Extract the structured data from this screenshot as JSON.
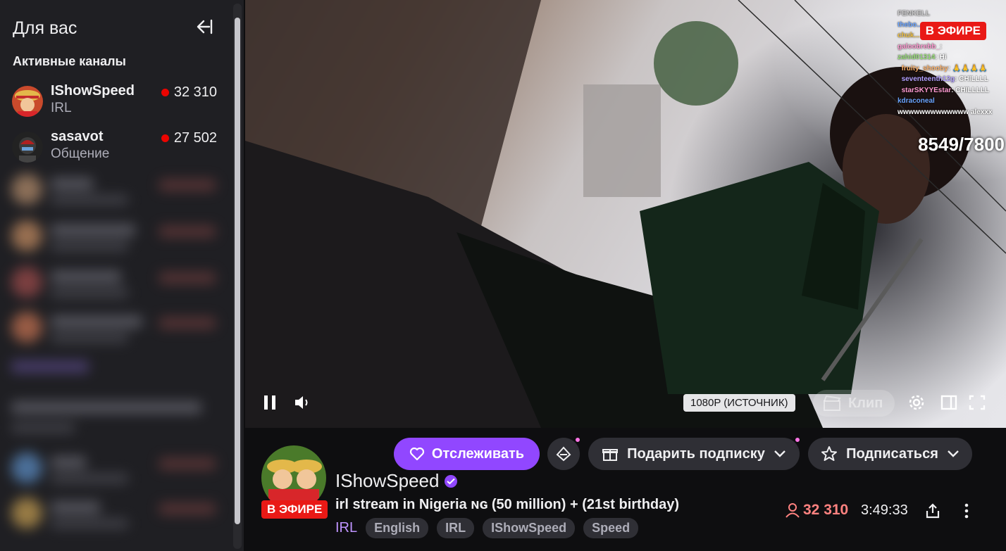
{
  "sidebar": {
    "header": "Для вас",
    "section_title": "Активные каналы",
    "channels": [
      {
        "name": "IShowSpeed",
        "category": "IRL",
        "viewers": "32 310"
      },
      {
        "name": "sasavot",
        "category": "Общение",
        "viewers": "27 502"
      }
    ]
  },
  "video": {
    "live_label": "В ЭФИРЕ",
    "counter": "8549/7800",
    "quality": "1080P (ИСТОЧНИК)",
    "clip_label": "Клип",
    "chat": [
      {
        "user": "FENKELL",
        "msg": "",
        "color": "#c8c8c8"
      },
      {
        "user": "galoobrebb_",
        "msg": "",
        "color": "#ff9ad1"
      },
      {
        "user": "zahid01314",
        "msg": "Hi",
        "color": "#9ae07a"
      },
      {
        "user": "fruity_shooby",
        "msg": "",
        "color": "#ffb36b"
      },
      {
        "user": "seventeenth12g",
        "msg": "CHILLLL",
        "color": "#b2a0ff"
      },
      {
        "user": "starSKYYEstar",
        "msg": "CHILLLLL",
        "color": "#ff9ad1"
      },
      {
        "user": "kdraconeal",
        "msg": "",
        "color": "#6aa4ff"
      },
      {
        "user": "wwwwwwwwwwwww alexxx",
        "msg": "",
        "color": "#ffffff"
      }
    ]
  },
  "info": {
    "live_badge": "В ЭФИРЕ",
    "follow_label": "Отслеживать",
    "gift_label": "Подарить подписку",
    "subscribe_label": "Подписаться",
    "streamer_name": "IShowSpeed",
    "stream_title": "irl stream in Nigeria ɴɢ (50 million) + (21st birthday)",
    "category": "IRL",
    "tags": [
      "English",
      "IRL",
      "IShowSpeed",
      "Speed"
    ],
    "viewers": "32 310",
    "uptime": "3:49:33"
  },
  "colors": {
    "accent": "#9147ff",
    "live": "#e91916",
    "viewer_red": "#ff8280",
    "category_link": "#bf94ff"
  }
}
